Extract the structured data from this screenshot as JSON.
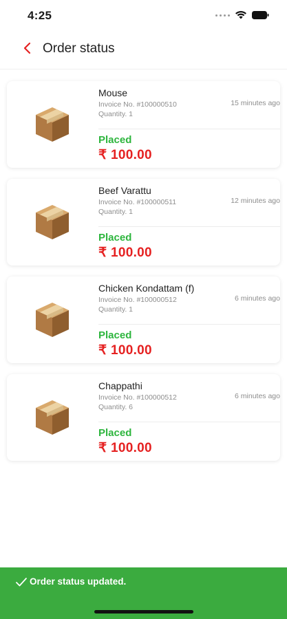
{
  "status_bar": {
    "time": "4:25"
  },
  "header": {
    "title": "Order status"
  },
  "orders": [
    {
      "name": "Mouse",
      "invoice": "Invoice No. #100000510",
      "quantity": "Quantity. 1",
      "time_ago": "15 minutes ago",
      "status": "Placed",
      "price": "₹ 100.00"
    },
    {
      "name": "Beef Varattu",
      "invoice": "Invoice No. #100000511",
      "quantity": "Quantity. 1",
      "time_ago": "12 minutes ago",
      "status": "Placed",
      "price": "₹ 100.00"
    },
    {
      "name": "Chicken Kondattam (f)",
      "invoice": "Invoice No. #100000512",
      "quantity": "Quantity. 1",
      "time_ago": "6 minutes ago",
      "status": "Placed",
      "price": "₹ 100.00"
    },
    {
      "name": "Chappathi",
      "invoice": "Invoice No. #100000512",
      "quantity": "Quantity. 6",
      "time_ago": "6 minutes ago",
      "status": "Placed",
      "price": "₹ 100.00"
    }
  ],
  "snackbar": {
    "message": "Order status updated."
  },
  "colors": {
    "accent_red": "#e52121",
    "status_green": "#2db53d",
    "snackbar_green": "#3bab3f"
  },
  "icons": {
    "back": "chevron-left-icon",
    "item": "package-box-icon",
    "snackbar": "check-icon"
  }
}
